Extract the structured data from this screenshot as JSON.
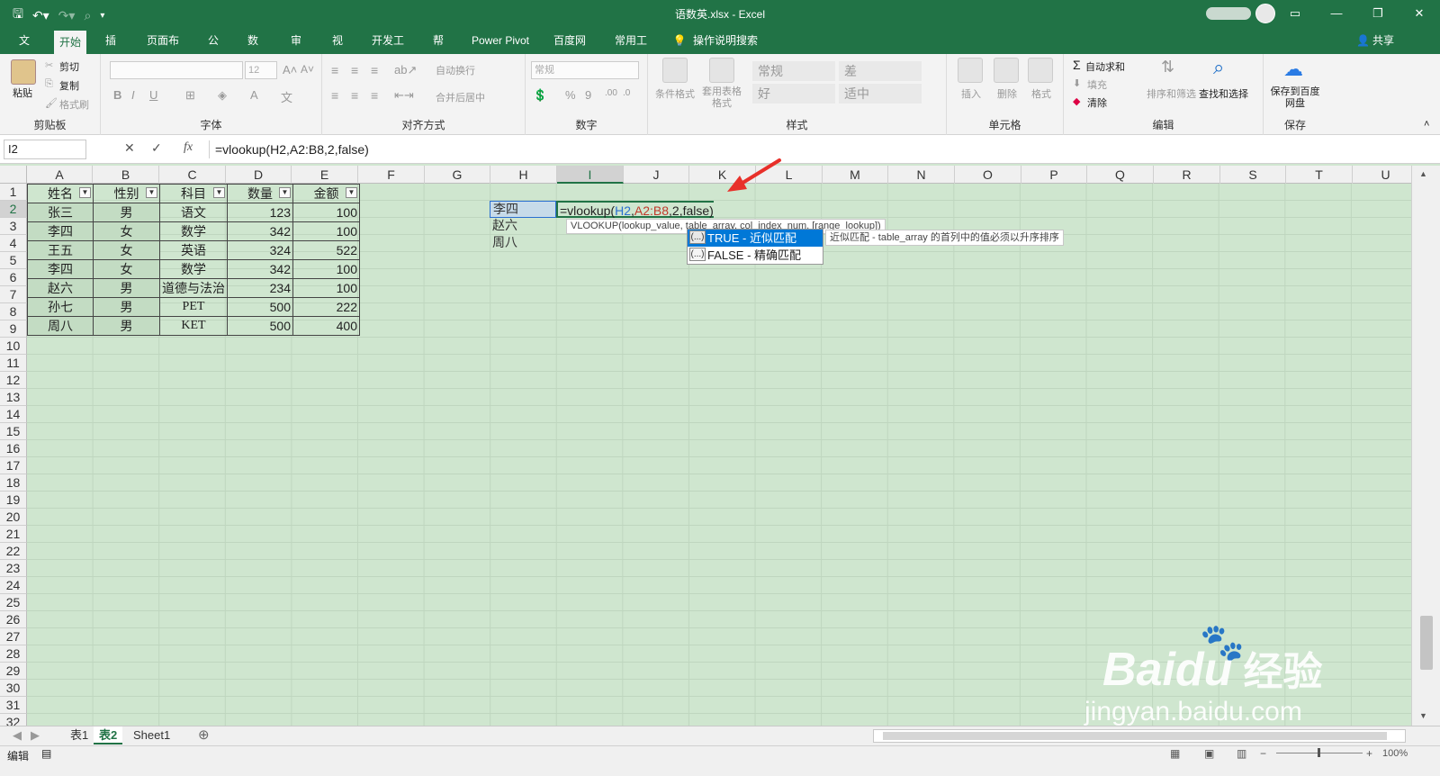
{
  "window": {
    "title": "语数英.xlsx  -  Excel"
  },
  "qat": {
    "save_icon": "save-icon",
    "undo_icon": "undo-icon",
    "redo_icon": "redo-icon"
  },
  "tabs": [
    "文件",
    "开始",
    "插入",
    "页面布局",
    "公式",
    "数据",
    "审阅",
    "视图",
    "开发工具",
    "帮助",
    "Power Pivot",
    "百度网盘",
    "常用工具",
    "操作说明搜索"
  ],
  "share": "共享",
  "ribbon": {
    "clipboard": {
      "label": "剪贴板",
      "paste": "粘贴",
      "cut": "剪切",
      "copy": "复制",
      "format_painter": "格式刷"
    },
    "font": {
      "label": "字体",
      "size": "12",
      "bold": "B",
      "italic": "I",
      "underline": "U"
    },
    "alignment": {
      "label": "对齐方式",
      "wrap": "自动换行",
      "merge": "合并后居中"
    },
    "number": {
      "label": "数字",
      "format": "常规",
      "percent": "%",
      "comma": "9"
    },
    "styles": {
      "label": "样式",
      "cond_format": "条件格式",
      "table_format": "套用表格格式",
      "cells": [
        "常规",
        "差",
        "好",
        "适中"
      ]
    },
    "cells": {
      "label": "单元格",
      "insert": "插入",
      "delete": "删除",
      "format": "格式"
    },
    "editing": {
      "label": "编辑",
      "autosum": "自动求和",
      "fill": "填充",
      "clear": "清除",
      "sort": "排序和筛选",
      "find": "查找和选择"
    },
    "save": {
      "label": "保存",
      "button": "保存到百度网盘"
    }
  },
  "formula_bar": {
    "name_box": "I2",
    "fx": "fx",
    "formula": "=vlookup(H2,A2:B8,2,false)"
  },
  "columns": [
    "A",
    "B",
    "C",
    "D",
    "E",
    "F",
    "G",
    "H",
    "I",
    "J",
    "K",
    "L",
    "M",
    "N",
    "O",
    "P",
    "Q",
    "R",
    "S",
    "T",
    "U"
  ],
  "rows": [
    "1",
    "2",
    "3",
    "4",
    "5",
    "6",
    "7",
    "8",
    "9",
    "10",
    "11",
    "12",
    "13",
    "14",
    "15",
    "16",
    "17",
    "18",
    "19",
    "20",
    "21",
    "22",
    "23",
    "24",
    "25",
    "26",
    "27",
    "28",
    "29",
    "30",
    "31",
    "32"
  ],
  "table": {
    "headers": [
      "姓名",
      "性别",
      "科目",
      "数量",
      "金额"
    ],
    "rows": [
      [
        "张三",
        "男",
        "语文",
        "123",
        "100"
      ],
      [
        "李四",
        "女",
        "数学",
        "342",
        "100"
      ],
      [
        "王五",
        "女",
        "英语",
        "324",
        "522"
      ],
      [
        "李四",
        "女",
        "数学",
        "342",
        "100"
      ],
      [
        "赵六",
        "男",
        "道德与法治",
        "234",
        "100"
      ],
      [
        "孙七",
        "男",
        "PET",
        "500",
        "222"
      ],
      [
        "周八",
        "男",
        "KET",
        "500",
        "400"
      ]
    ]
  },
  "h_column": [
    "李四",
    "赵六",
    "周八"
  ],
  "edit": {
    "prefix": "=vlookup(",
    "ref1": "H2",
    "comma1": ",",
    "ref2": "A2:B8",
    "rest": ",2,false)"
  },
  "tooltip": "VLOOKUP(lookup_value, table_array, col_index_num, [range_lookup])",
  "autocomplete": [
    {
      "icon": "(...)",
      "label": "TRUE - 近似匹配"
    },
    {
      "icon": "(...)",
      "label": "FALSE - 精确匹配"
    }
  ],
  "ac_description": "近似匹配 - table_array 的首列中的值必须以升序排序",
  "sheets": [
    "表1",
    "表2",
    "Sheet1"
  ],
  "status": {
    "mode": "编辑",
    "zoom": "100%"
  },
  "watermark": {
    "brand": "Bai",
    "brand2": "du",
    "cn": "经验",
    "url": "jingyan.baidu.com"
  }
}
